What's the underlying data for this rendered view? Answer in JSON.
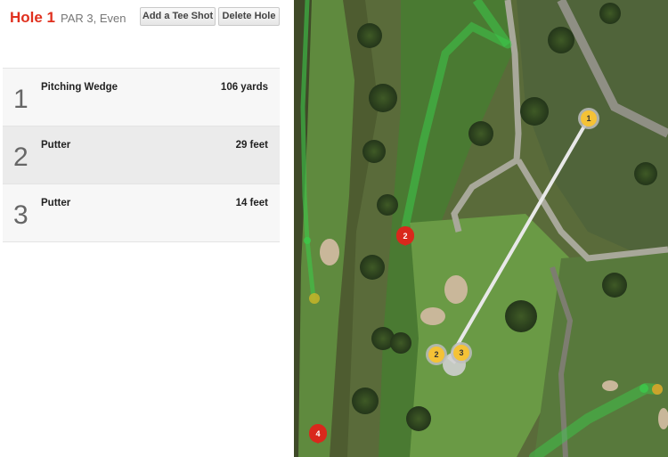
{
  "hole": {
    "title": "Hole 1",
    "subtitle": "PAR 3, Even"
  },
  "toolbar": {
    "add_tee_shot_label": "Add a Tee Shot",
    "delete_hole_label": "Delete Hole"
  },
  "shots": [
    {
      "number": "1",
      "club": "Pitching Wedge",
      "distance": "106 yards"
    },
    {
      "number": "2",
      "club": "Putter",
      "distance": "29 feet"
    },
    {
      "number": "3",
      "club": "Putter",
      "distance": "14 feet"
    }
  ],
  "map": {
    "markers": {
      "shot_1": "1",
      "shot_2": "2",
      "shot_3": "3",
      "other_hole_2": "2",
      "other_hole_4": "4"
    },
    "colors": {
      "shot_marker": "#f5c236",
      "hole_marker": "#d9281c",
      "shot_line": "#e8e8e8",
      "hole_path": "#3cc84a"
    }
  }
}
